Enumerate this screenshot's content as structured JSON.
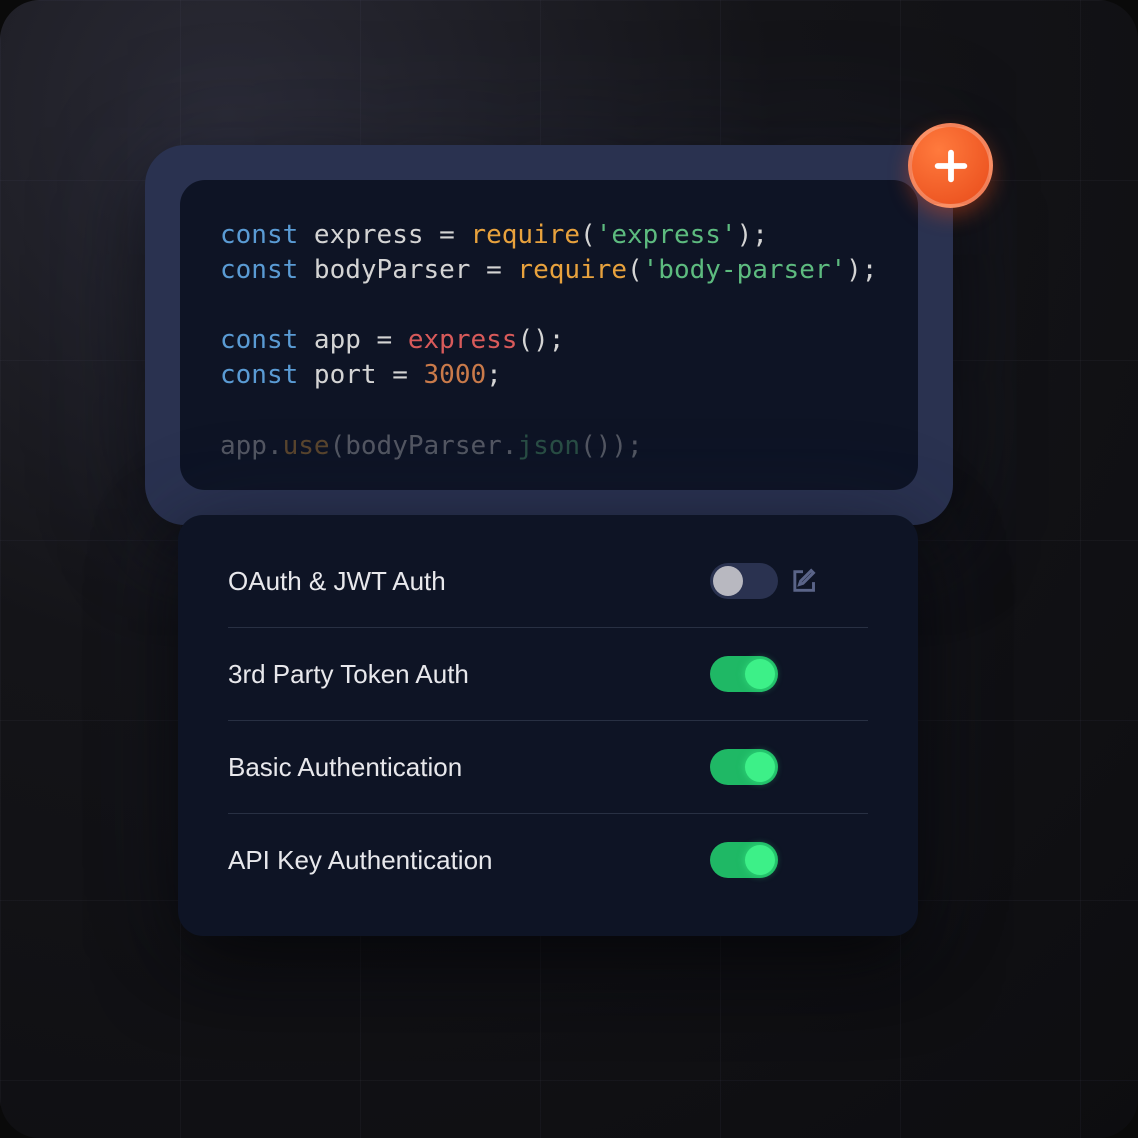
{
  "code": {
    "lines": [
      {
        "tokens": [
          {
            "text": "const ",
            "cls": "tk-keyword"
          },
          {
            "text": "express ",
            "cls": "tk-var"
          },
          {
            "text": "= ",
            "cls": "tk-op"
          },
          {
            "text": "require",
            "cls": "tk-func"
          },
          {
            "text": "(",
            "cls": "tk-punct"
          },
          {
            "text": "'express'",
            "cls": "tk-string"
          },
          {
            "text": ");",
            "cls": "tk-punct"
          }
        ]
      },
      {
        "tokens": [
          {
            "text": "const ",
            "cls": "tk-keyword"
          },
          {
            "text": "bodyParser ",
            "cls": "tk-var"
          },
          {
            "text": "= ",
            "cls": "tk-op"
          },
          {
            "text": "require",
            "cls": "tk-func"
          },
          {
            "text": "(",
            "cls": "tk-punct"
          },
          {
            "text": "'body-parser'",
            "cls": "tk-string"
          },
          {
            "text": ");",
            "cls": "tk-punct"
          }
        ]
      },
      {
        "tokens": [
          {
            "text": " ",
            "cls": ""
          }
        ]
      },
      {
        "tokens": [
          {
            "text": "const ",
            "cls": "tk-keyword"
          },
          {
            "text": "app ",
            "cls": "tk-var"
          },
          {
            "text": "= ",
            "cls": "tk-op"
          },
          {
            "text": "express",
            "cls": "tk-func-red"
          },
          {
            "text": "();",
            "cls": "tk-punct"
          }
        ]
      },
      {
        "tokens": [
          {
            "text": "const ",
            "cls": "tk-keyword"
          },
          {
            "text": "port ",
            "cls": "tk-var"
          },
          {
            "text": "= ",
            "cls": "tk-op"
          },
          {
            "text": "3000",
            "cls": "tk-number"
          },
          {
            "text": ";",
            "cls": "tk-punct"
          }
        ]
      },
      {
        "tokens": [
          {
            "text": " ",
            "cls": ""
          }
        ]
      },
      {
        "faded": true,
        "tokens": [
          {
            "text": "app",
            "cls": "tk-var"
          },
          {
            "text": ".",
            "cls": "tk-punct"
          },
          {
            "text": "use",
            "cls": "tk-func"
          },
          {
            "text": "(",
            "cls": "tk-punct"
          },
          {
            "text": "bodyParser",
            "cls": "tk-var"
          },
          {
            "text": ".",
            "cls": "tk-punct"
          },
          {
            "text": "json",
            "cls": "tk-method"
          },
          {
            "text": "());",
            "cls": "tk-punct"
          }
        ]
      }
    ]
  },
  "settings": {
    "items": [
      {
        "label": "OAuth & JWT Auth",
        "enabled": false,
        "editable": true
      },
      {
        "label": "3rd Party Token Auth",
        "enabled": true,
        "editable": false
      },
      {
        "label": "Basic Authentication",
        "enabled": true,
        "editable": false
      },
      {
        "label": "API Key Authentication",
        "enabled": true,
        "editable": false
      }
    ]
  }
}
